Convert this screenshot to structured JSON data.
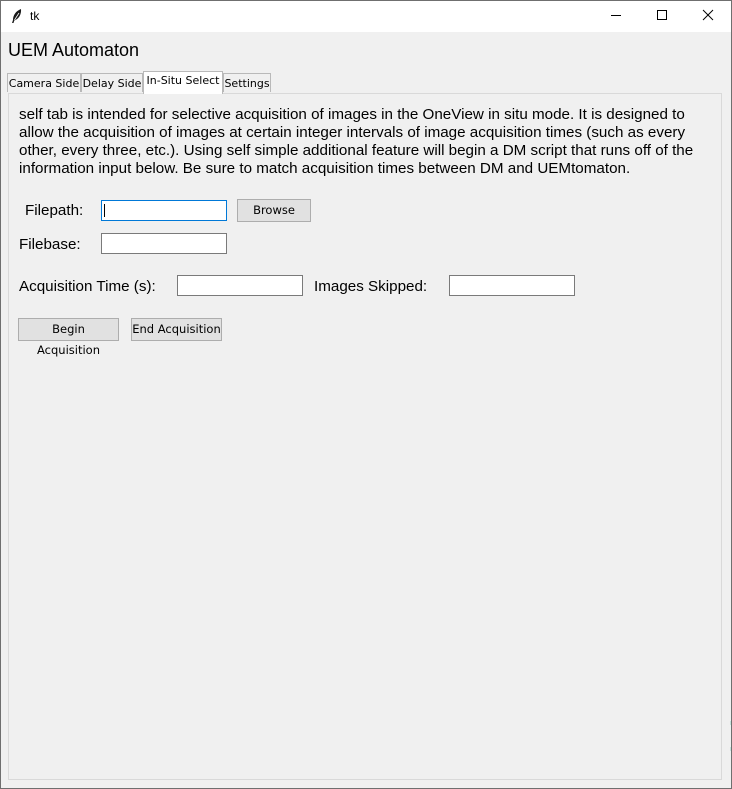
{
  "window": {
    "title": "tk",
    "icon": "feather-icon",
    "controls": [
      "minimize-icon",
      "maximize-icon",
      "close-icon"
    ]
  },
  "app": {
    "heading": "UEM Automaton"
  },
  "tabs": [
    {
      "label": "Camera Side",
      "selected": false
    },
    {
      "label": "Delay Side",
      "selected": false
    },
    {
      "label": "In-Situ Select",
      "selected": true
    },
    {
      "label": "Settings",
      "selected": false
    }
  ],
  "insitu": {
    "description": "self tab is intended for selective acquisition of images in the OneView in situ mode. It is designed to allow the acquisition of images at certain integer intervals of image acquisition times (such as every other, every three, etc.). Using self simple additional feature will begin a DM script that runs off of the information input below. Be sure to match acquisition times between DM and UEMtomaton.",
    "filepath": {
      "label": "Filepath:",
      "value": "",
      "placeholder": ""
    },
    "browse_label": "Browse",
    "filebase": {
      "label": "Filebase:",
      "value": "",
      "placeholder": ""
    },
    "acq_time": {
      "label": "Acquisition Time (s):",
      "value": "",
      "placeholder": ""
    },
    "images_skipped": {
      "label": "Images Skipped:",
      "value": "",
      "placeholder": ""
    },
    "begin_label": "Begin Acquisition",
    "end_label": "End Acquisition"
  }
}
